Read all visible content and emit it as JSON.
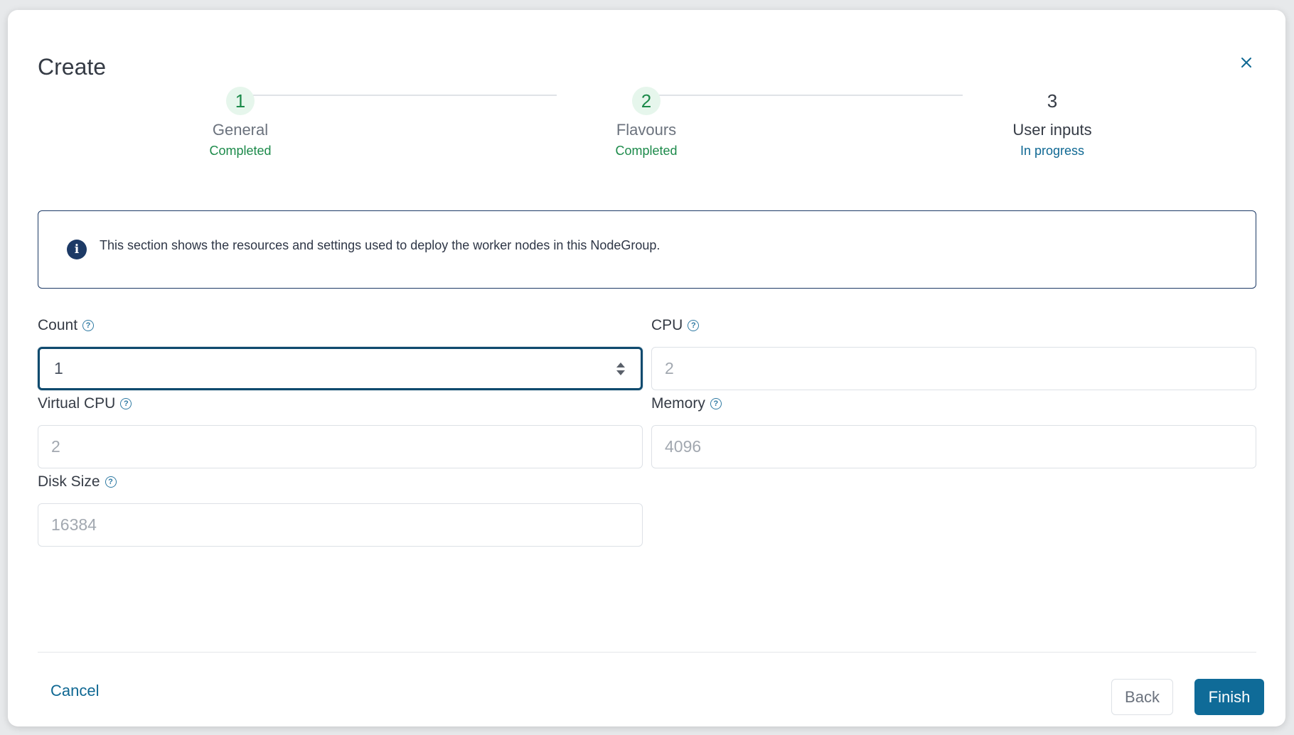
{
  "modal": {
    "title": "Create",
    "close_icon": "close-icon"
  },
  "stepper": {
    "steps": [
      {
        "number": "1",
        "title": "General",
        "status": "Completed",
        "state": "done"
      },
      {
        "number": "2",
        "title": "Flavours",
        "status": "Completed",
        "state": "done"
      },
      {
        "number": "3",
        "title": "User inputs",
        "status": "In progress",
        "state": "active"
      }
    ]
  },
  "info": {
    "icon": "info-icon",
    "text": "This section shows the resources and settings used to deploy the worker nodes in this NodeGroup."
  },
  "fields": {
    "count": {
      "label": "Count",
      "value": "1"
    },
    "cpu": {
      "label": "CPU",
      "value": "2"
    },
    "virtual_cpu": {
      "label": "Virtual CPU",
      "value": "2"
    },
    "memory": {
      "label": "Memory",
      "value": "4096"
    },
    "disk_size": {
      "label": "Disk Size",
      "value": "16384"
    }
  },
  "footer": {
    "cancel_label": "Cancel",
    "back_label": "Back",
    "finish_label": "Finish"
  },
  "colors": {
    "accent": "#0f6b98",
    "success": "#1c8a4a",
    "info_border": "#1d3a66"
  }
}
